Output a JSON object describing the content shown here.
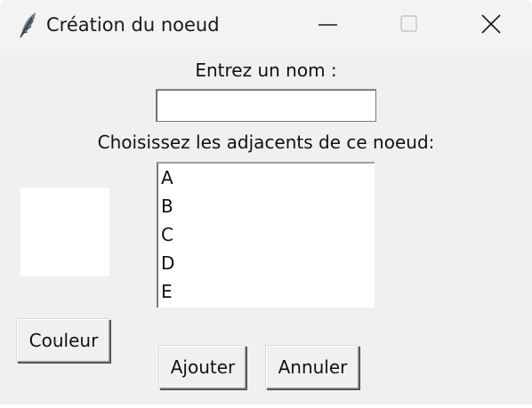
{
  "window": {
    "title": "Création du noeud",
    "icon": "feather-icon",
    "controls": [
      "minimize-icon",
      "maximize-icon",
      "close-icon"
    ]
  },
  "form": {
    "name_label": "Entrez un nom :",
    "name_value": "",
    "adjacent_label": "Choisissez les adjacents de ce noeud:",
    "adjacent_options": [
      "A",
      "B",
      "C",
      "D",
      "E"
    ],
    "color_preview": "#ffffff"
  },
  "buttons": {
    "color": "Couleur",
    "add": "Ajouter",
    "cancel": "Annuler"
  }
}
